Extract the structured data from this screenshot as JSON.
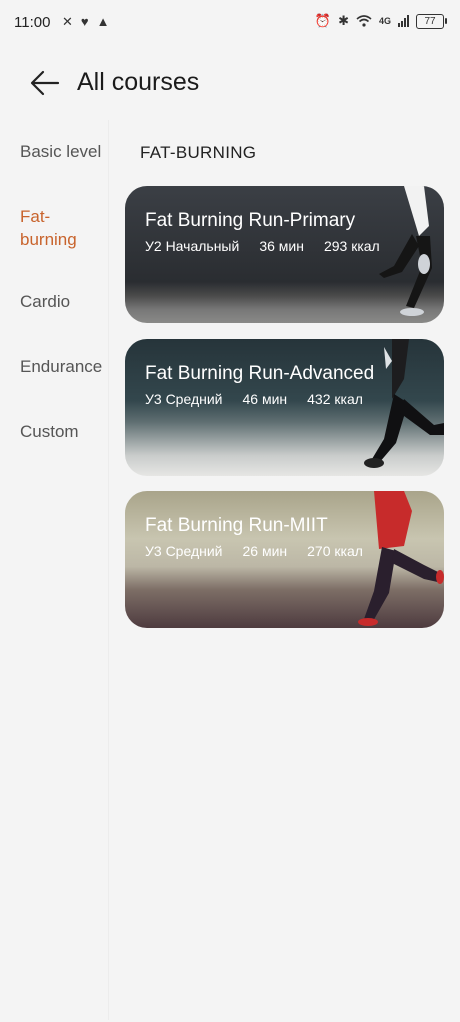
{
  "status": {
    "time": "11:00",
    "network": "4G",
    "battery": "77"
  },
  "header": {
    "title": "All courses"
  },
  "sidebar": {
    "items": [
      {
        "label": "Basic level"
      },
      {
        "label": "Fat-\nburning"
      },
      {
        "label": "Cardio"
      },
      {
        "label": "Endurance"
      },
      {
        "label": "Custom"
      }
    ]
  },
  "main": {
    "section_title": "FAT-BURNING",
    "courses": [
      {
        "title": "Fat Burning Run-Primary",
        "level": "У2 Начальный",
        "duration": "36 мин",
        "calories": "293 ккал"
      },
      {
        "title": "Fat Burning Run-Advanced",
        "level": "У3 Средний",
        "duration": "46 мин",
        "calories": "432 ккал"
      },
      {
        "title": "Fat Burning Run-MIIT",
        "level": "У3 Средний",
        "duration": "26 мин",
        "calories": "270 ккал"
      }
    ]
  },
  "colors": {
    "accent": "#c8632c",
    "background": "#f4f4f4",
    "text": "#222222"
  },
  "icons": {
    "back": "arrow-left-icon"
  }
}
